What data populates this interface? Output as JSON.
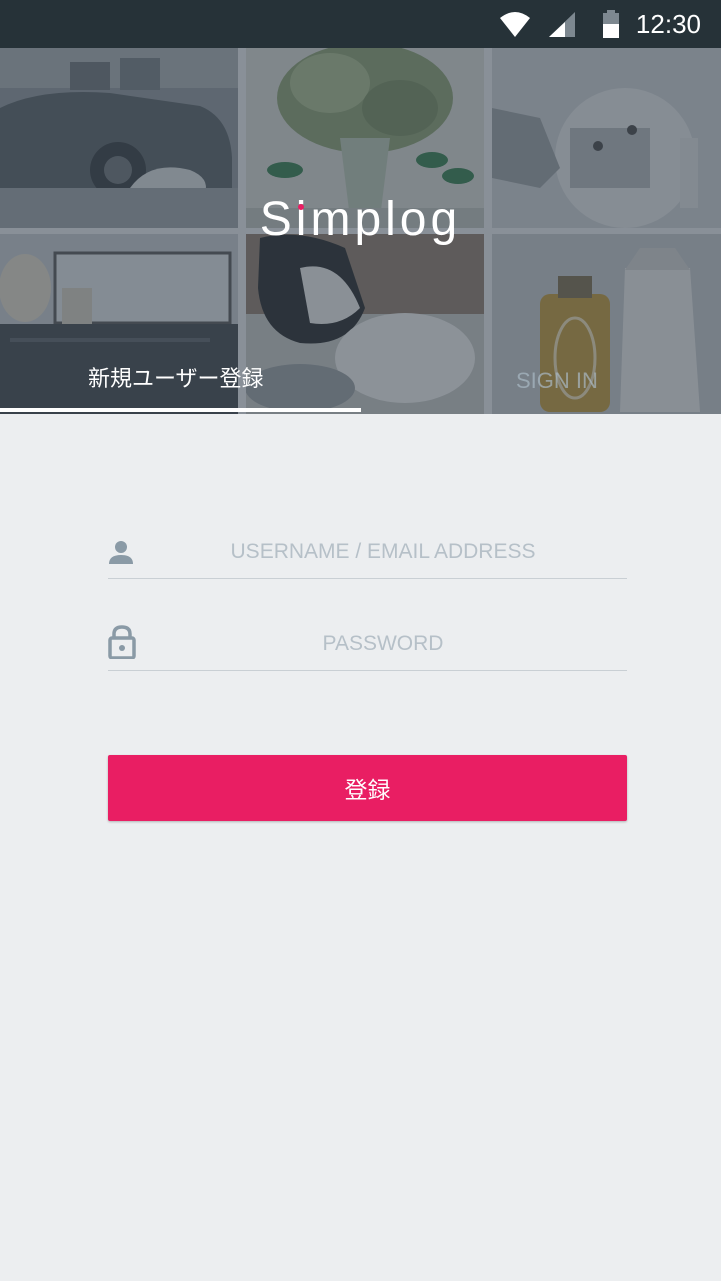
{
  "status_bar": {
    "time": "12:30",
    "icons": [
      "wifi-icon",
      "cell-signal-icon",
      "battery-icon"
    ]
  },
  "header": {
    "logo_text": "Simplog",
    "tabs": [
      {
        "label": "新規ユーザー登録",
        "active": true
      },
      {
        "label": "SIGN IN",
        "active": false
      }
    ]
  },
  "form": {
    "username": {
      "icon": "person-icon",
      "value": "",
      "placeholder": "USERNAME / EMAIL ADDRESS"
    },
    "password": {
      "icon": "lock-icon",
      "value": "",
      "placeholder": "PASSWORD"
    },
    "submit_label": "登録"
  },
  "colors": {
    "accent": "#e91e63",
    "status_bar": "#263238",
    "background": "#eceef0",
    "icon": "#8a9aa6"
  }
}
